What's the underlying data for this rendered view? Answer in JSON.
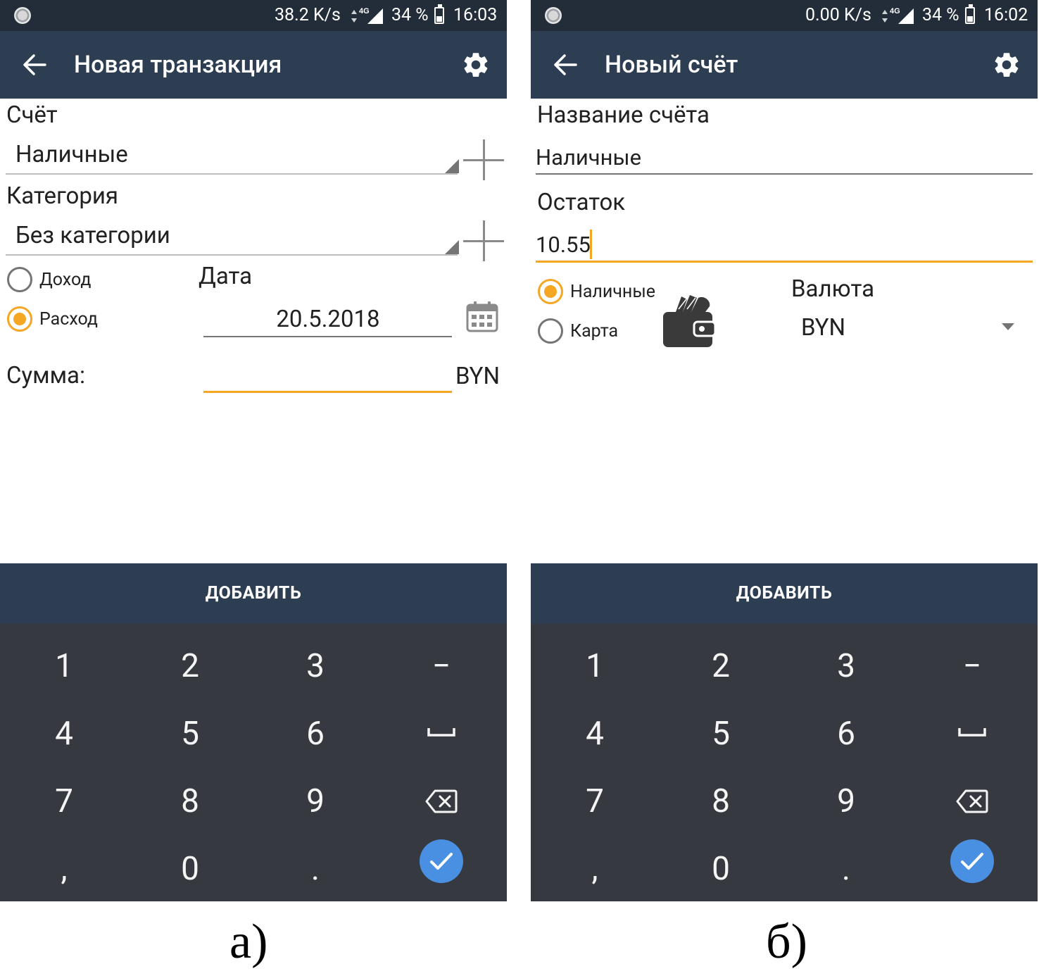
{
  "screens": [
    {
      "status": {
        "speed": "38.2 K/s",
        "network": "4G",
        "battery": "34 %",
        "time": "16:03"
      },
      "appbar": {
        "title": "Новая транзакция"
      },
      "account_label": "Счёт",
      "account_value": "Наличные",
      "category_label": "Категория",
      "category_value": "Без категории",
      "type_options": [
        {
          "label": "Доход",
          "selected": false
        },
        {
          "label": "Расход",
          "selected": true
        }
      ],
      "date_label": "Дата",
      "date_value": "20.5.2018",
      "amount_label": "Сумма:",
      "amount_currency": "BYN",
      "add_button": "ДОБАВИТЬ",
      "caption": "а)"
    },
    {
      "status": {
        "speed": "0.00 K/s",
        "network": "4G",
        "battery": "34 %",
        "time": "16:02"
      },
      "appbar": {
        "title": "Новый счёт"
      },
      "name_label": "Название счёта",
      "name_value": "Наличные",
      "balance_label": "Остаток",
      "balance_value": "10.55",
      "type_options": [
        {
          "label": "Наличные",
          "selected": true
        },
        {
          "label": "Карта",
          "selected": false
        }
      ],
      "currency_label": "Валюта",
      "currency_value": "BYN",
      "add_button": "ДОБАВИТЬ",
      "caption": "б)"
    }
  ],
  "keypad": {
    "keys": [
      "1",
      "2",
      "3",
      "−",
      "4",
      "5",
      "6",
      "7",
      "8",
      "9",
      ",",
      "0",
      "."
    ],
    "icons": [
      "space-key-icon",
      "backspace-icon",
      "checkmark-icon"
    ]
  },
  "colors": {
    "status_bar": "#232d39",
    "app_bar": "#2e3e52",
    "keypad": "#363a40",
    "accent": "#f5a623",
    "done_button": "#4a90e2"
  }
}
